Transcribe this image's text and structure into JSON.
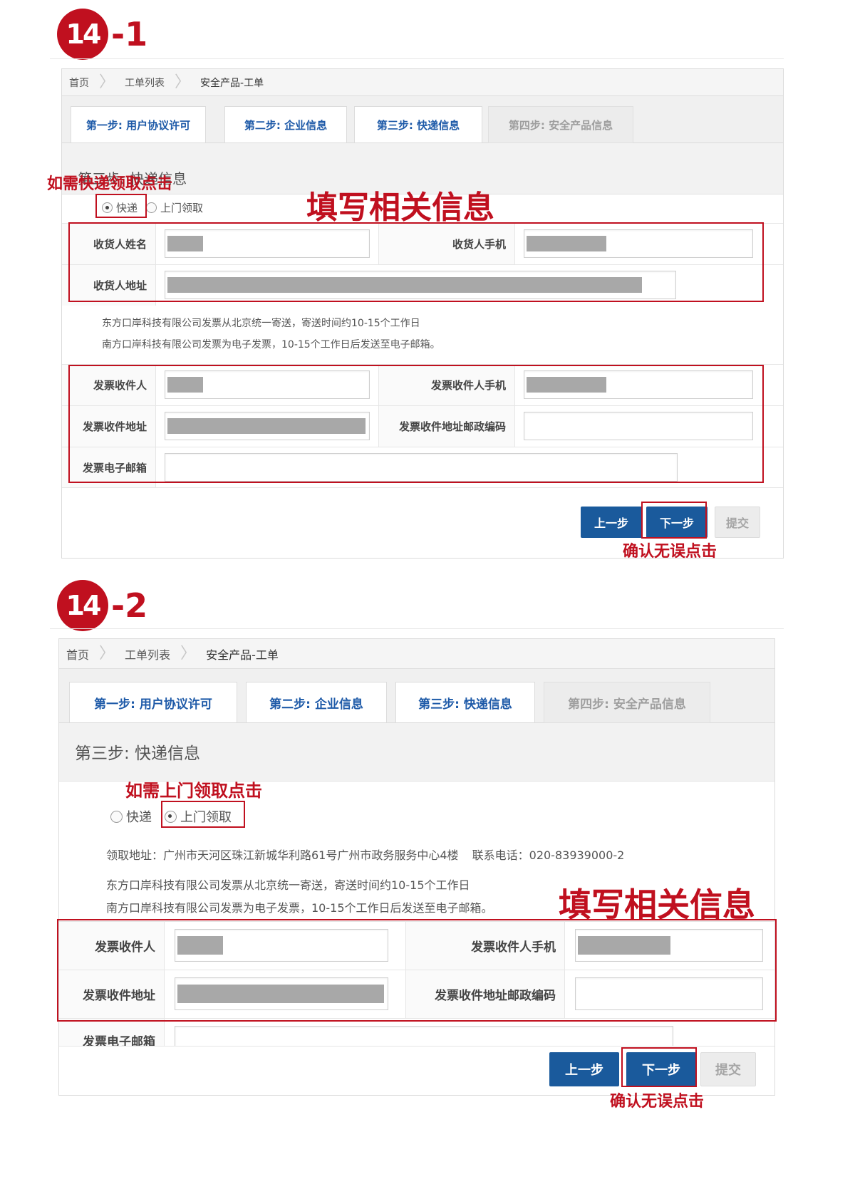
{
  "colors": {
    "annotation_red": "#c0101f",
    "primary_blue": "#1a5a9c",
    "tab_blue": "#1e5aa8"
  },
  "section1": {
    "step_number": "14",
    "step_suffix": "-1",
    "breadcrumb": [
      "首页",
      "工单列表",
      "安全产品-工单"
    ],
    "tabs": [
      {
        "label": "第一步: 用户协议许可",
        "state": "active"
      },
      {
        "label": "第二步: 企业信息",
        "state": "active"
      },
      {
        "label": "第三步: 快递信息",
        "state": "active"
      },
      {
        "label": "第四步: 安全产品信息",
        "state": "disabled"
      }
    ],
    "subheading": "第三步: 快递信息",
    "callout_radio": "如需快递领取点击",
    "radio_options": [
      {
        "label": "快递",
        "checked": true
      },
      {
        "label": "上门领取",
        "checked": false
      }
    ],
    "callout_fill": "填写相关信息",
    "receiver_fields": {
      "name_label": "收货人姓名",
      "phone_label": "收货人手机",
      "address_label": "收货人地址"
    },
    "notes": [
      "东方口岸科技有限公司发票从北京统一寄送，寄送时间约10-15个工作日",
      "南方口岸科技有限公司发票为电子发票，10-15个工作日后发送至电子邮箱。"
    ],
    "invoice_fields": {
      "receiver_label": "发票收件人",
      "receiver_phone_label": "发票收件人手机",
      "address_label": "发票收件地址",
      "postcode_label": "发票收件地址邮政编码",
      "email_label": "发票电子邮箱"
    },
    "buttons": {
      "prev": "上一步",
      "next": "下一步",
      "submit": "提交"
    },
    "callout_confirm": "确认无误点击"
  },
  "section2": {
    "step_number": "14",
    "step_suffix": "-2",
    "breadcrumb": [
      "首页",
      "工单列表",
      "安全产品-工单"
    ],
    "tabs": [
      {
        "label": "第一步: 用户协议许可",
        "state": "active"
      },
      {
        "label": "第二步: 企业信息",
        "state": "active"
      },
      {
        "label": "第三步: 快递信息",
        "state": "active"
      },
      {
        "label": "第四步: 安全产品信息",
        "state": "disabled"
      }
    ],
    "subheading": "第三步: 快递信息",
    "callout_radio": "如需上门领取点击",
    "radio_options": [
      {
        "label": "快递",
        "checked": false
      },
      {
        "label": "上门领取",
        "checked": true
      }
    ],
    "pickup_address": "领取地址：广州市天河区珠江新城华利路61号广州市政务服务中心4楼",
    "pickup_phone": "联系电话：020-83939000-2",
    "notes": [
      "东方口岸科技有限公司发票从北京统一寄送，寄送时间约10-15个工作日",
      "南方口岸科技有限公司发票为电子发票，10-15个工作日后发送至电子邮箱。"
    ],
    "callout_fill": "填写相关信息",
    "invoice_fields": {
      "receiver_label": "发票收件人",
      "receiver_phone_label": "发票收件人手机",
      "address_label": "发票收件地址",
      "postcode_label": "发票收件地址邮政编码",
      "email_label": "发票电子邮箱"
    },
    "buttons": {
      "prev": "上一步",
      "next": "下一步",
      "submit": "提交"
    },
    "callout_confirm": "确认无误点击"
  }
}
